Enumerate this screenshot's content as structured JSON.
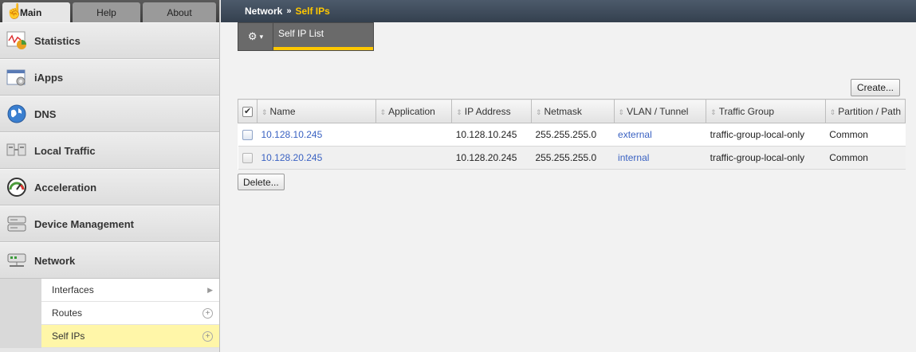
{
  "sidebar": {
    "tabs": [
      {
        "label": "Main"
      },
      {
        "label": "Help"
      },
      {
        "label": "About"
      }
    ],
    "items": [
      {
        "label": "Statistics",
        "icon": "statistics-icon"
      },
      {
        "label": "iApps",
        "icon": "iapps-icon"
      },
      {
        "label": "DNS",
        "icon": "dns-globe-icon"
      },
      {
        "label": "Local Traffic",
        "icon": "local-traffic-icon"
      },
      {
        "label": "Acceleration",
        "icon": "speedometer-icon"
      },
      {
        "label": "Device Management",
        "icon": "device-icon"
      },
      {
        "label": "Network",
        "icon": "network-icon"
      }
    ],
    "submenu": [
      {
        "label": "Interfaces",
        "control": "arrow"
      },
      {
        "label": "Routes",
        "control": "plus"
      },
      {
        "label": "Self IPs",
        "control": "plus",
        "selected": true
      }
    ]
  },
  "breadcrumb": {
    "section": "Network",
    "separator": "»",
    "current": "Self IPs"
  },
  "tabs": {
    "gear_symbol": "⚙",
    "gear_caret": "▾",
    "self_ip_list": "Self IP List"
  },
  "buttons": {
    "create": "Create...",
    "delete": "Delete..."
  },
  "table": {
    "sort_glyph": "⇕",
    "headers": [
      "Name",
      "Application",
      "IP Address",
      "Netmask",
      "VLAN / Tunnel",
      "Traffic Group",
      "Partition / Path"
    ],
    "rows": [
      {
        "name": "10.128.10.245",
        "application": "",
        "ip": "10.128.10.245",
        "netmask": "255.255.255.0",
        "vlan": "external",
        "traffic_group": "traffic-group-local-only",
        "partition": "Common"
      },
      {
        "name": "10.128.20.245",
        "application": "",
        "ip": "10.128.20.245",
        "netmask": "255.255.255.0",
        "vlan": "internal",
        "traffic_group": "traffic-group-local-only",
        "partition": "Common"
      }
    ]
  },
  "colors": {
    "accent": "#ffc800",
    "link": "#3a62c2",
    "topbar": "#3f4b5a",
    "selected_row": "#fff6a8"
  }
}
